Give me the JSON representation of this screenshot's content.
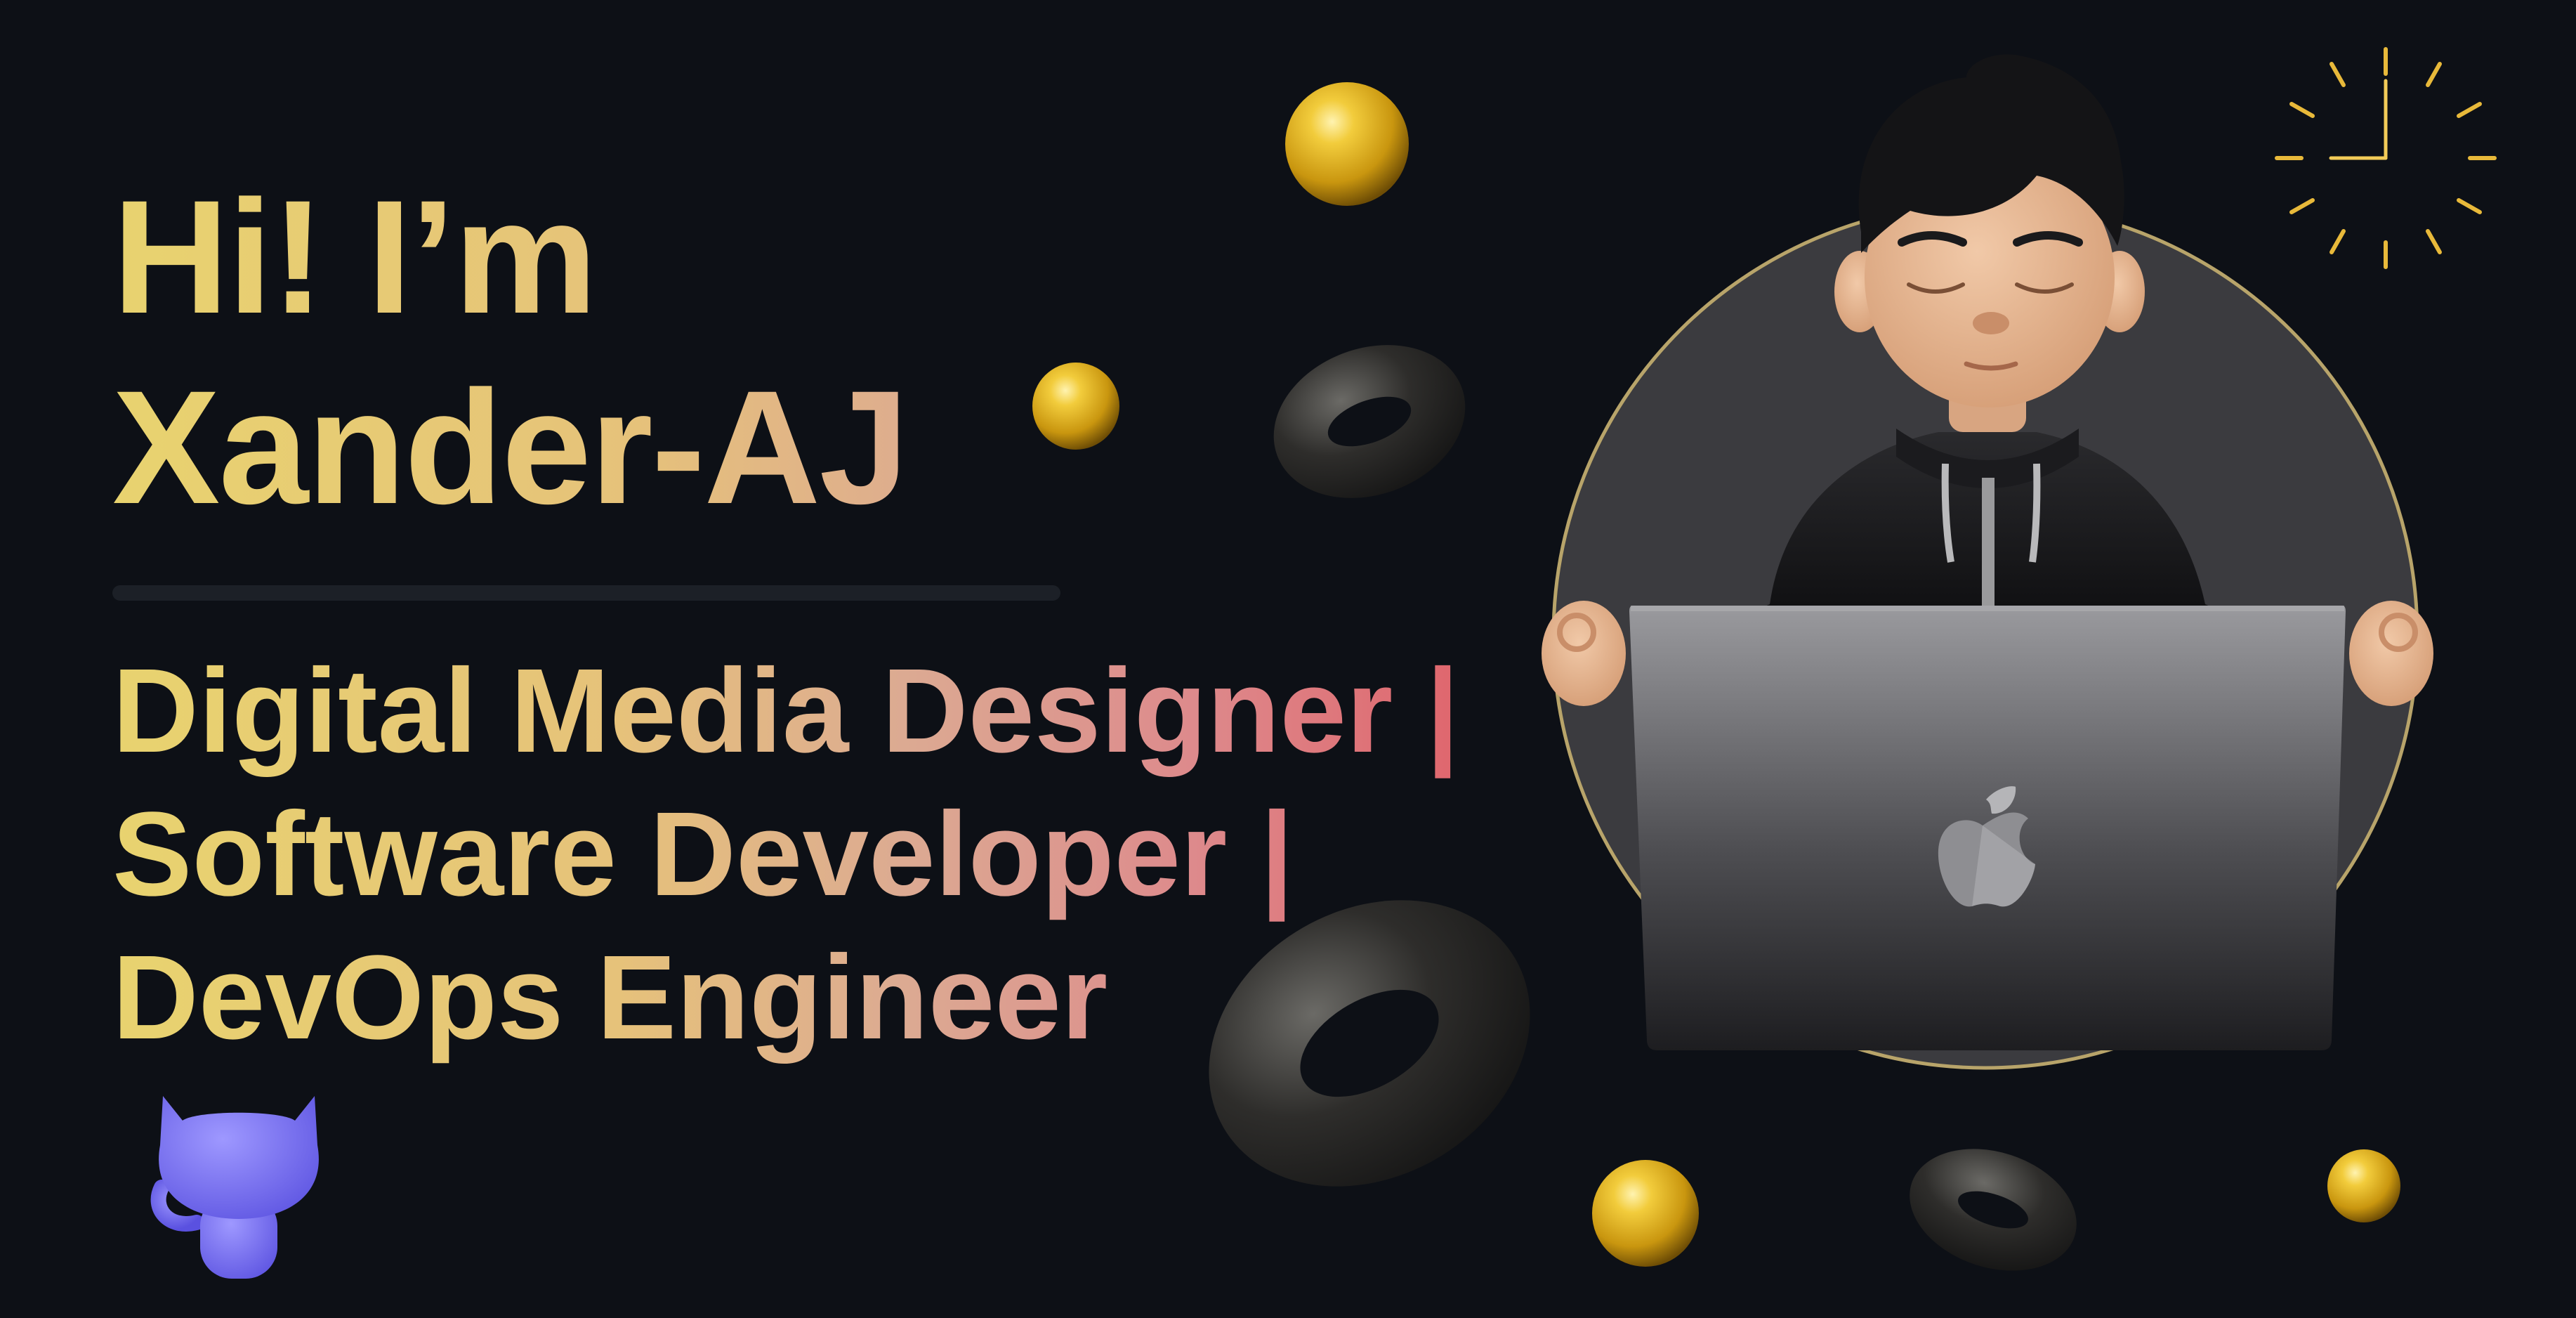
{
  "hero": {
    "greeting_line1": "Hi! I’m",
    "greeting_line2": "Xander-AJ",
    "roles": [
      "Digital Media Designer |",
      "Software Developer |",
      "DevOps Engineer"
    ]
  },
  "icons": {
    "octocat": "github-octocat-icon",
    "clock": "sunburst-clock-icon",
    "laptop_logo": "apple-logo-icon"
  },
  "colors": {
    "background": "#0d1016",
    "gradient_start": "#e8d36f",
    "gradient_end": "#e05a63",
    "sphere": "#e2b424",
    "octocat": "#7b73f5",
    "avatar_circle": "#3b3b3f",
    "avatar_ring": "#b8a46a"
  }
}
